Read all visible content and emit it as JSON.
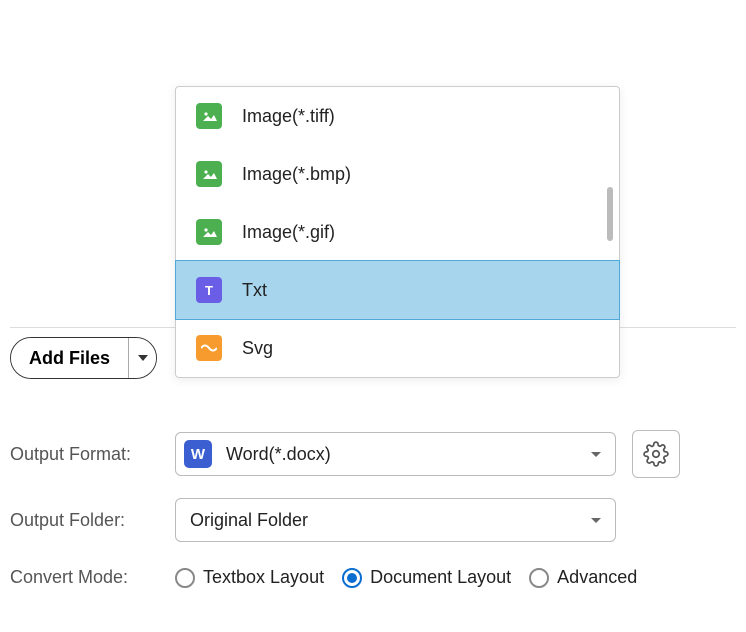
{
  "add_files": {
    "label": "Add Files"
  },
  "output_format": {
    "label": "Output Format:",
    "value": "Word(*.docx)",
    "icon_letter": "W",
    "options": [
      {
        "id": "tiff",
        "label": "Image(*.tiff)",
        "icon": "image",
        "selected": false
      },
      {
        "id": "bmp",
        "label": "Image(*.bmp)",
        "icon": "image",
        "selected": false
      },
      {
        "id": "gif",
        "label": "Image(*.gif)",
        "icon": "image",
        "selected": false
      },
      {
        "id": "txt",
        "label": "Txt",
        "icon": "txt",
        "selected": true
      },
      {
        "id": "svg",
        "label": "Svg",
        "icon": "svg",
        "selected": false
      }
    ]
  },
  "output_folder": {
    "label": "Output Folder:",
    "value": "Original Folder"
  },
  "convert_mode": {
    "label": "Convert Mode:",
    "options": [
      {
        "id": "textbox",
        "label": "Textbox Layout",
        "checked": false
      },
      {
        "id": "document",
        "label": "Document Layout",
        "checked": true
      },
      {
        "id": "advanced",
        "label": "Advanced",
        "checked": false
      }
    ]
  }
}
